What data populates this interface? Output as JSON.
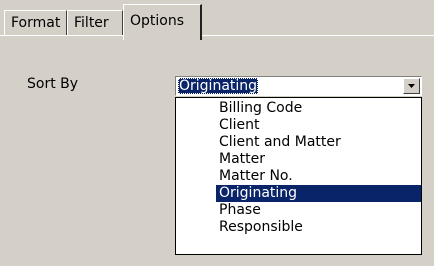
{
  "tabs": [
    {
      "label": "Format",
      "active": false
    },
    {
      "label": "Filter",
      "active": false
    },
    {
      "label": "Options",
      "active": true
    }
  ],
  "options": {
    "sort_by_label": "Sort By",
    "sort_by_value": "Originating",
    "sort_by_dropdown_icon": "chevron-down-icon",
    "sort_by_options": [
      "Billing Code",
      "Client",
      "Client and Matter",
      "Matter",
      "Matter No.",
      "Originating",
      "Phase",
      "Responsible"
    ],
    "selected_option": "Originating"
  },
  "colors": {
    "window_bg": "#d4d0c8",
    "selection_bg": "#0a246a",
    "selection_text": "#ffffff",
    "list_bg": "#ffffff"
  }
}
